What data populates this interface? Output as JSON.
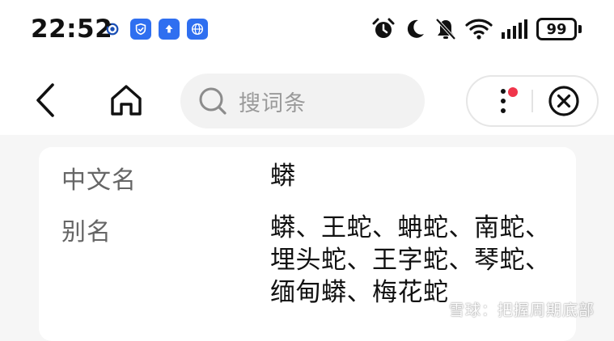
{
  "status_bar": {
    "time": "22:52",
    "battery_level": "99",
    "app_icons": [
      "app-icon",
      "cloud-shield-icon",
      "upload-icon",
      "globe-icon"
    ],
    "system_icons": [
      "alarm-icon",
      "moon-icon",
      "mute-bell-icon",
      "wifi-icon",
      "signal-icon",
      "battery-icon"
    ]
  },
  "toolbar": {
    "back_icon": "chevron-left-icon",
    "home_icon": "home-icon",
    "search_placeholder": "搜词条",
    "more_icon": "more-vertical-icon",
    "close_icon": "close-circle-icon",
    "notification_color": "#f0354b"
  },
  "entry": {
    "rows": [
      {
        "label": "中文名",
        "value": "蟒"
      },
      {
        "label": "别名",
        "value": "蟒、王蛇、蚺蛇、南蛇、埋头蛇、王字蛇、琴蛇、缅甸蟒、梅花蛇"
      }
    ]
  },
  "watermark": {
    "text": "雪球：把握周期底部"
  }
}
